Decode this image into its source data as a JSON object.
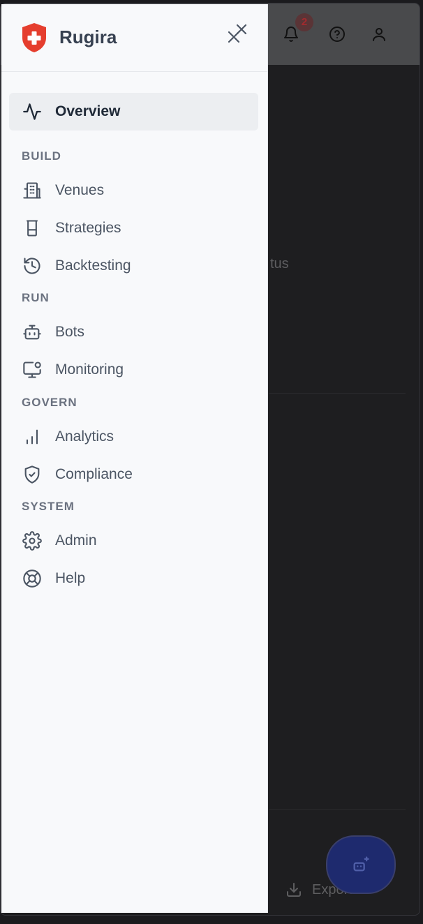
{
  "brand": {
    "name": "Rugira",
    "accent": "#e53e2e"
  },
  "header": {
    "notification_count": "2"
  },
  "nav": {
    "overview": {
      "label": "Overview",
      "icon": "activity-icon"
    },
    "sections": {
      "build": "BUILD",
      "run": "RUN",
      "govern": "GOVERN",
      "system": "SYSTEM"
    },
    "items": {
      "venues": "Venues",
      "strategies": "Strategies",
      "backtesting": "Backtesting",
      "bots": "Bots",
      "monitoring": "Monitoring",
      "analytics": "Analytics",
      "compliance": "Compliance",
      "admin": "Admin",
      "help": "Help"
    }
  },
  "background": {
    "partial_text": "tus",
    "export_label": "Export"
  }
}
